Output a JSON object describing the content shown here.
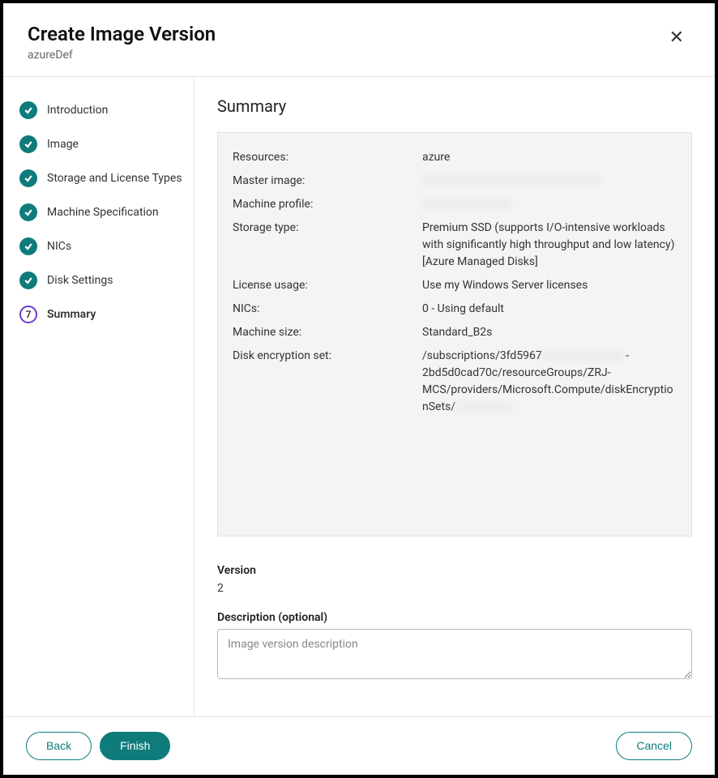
{
  "header": {
    "title": "Create Image Version",
    "subtitle": "azureDef"
  },
  "sidebar": {
    "steps": [
      {
        "label": "Introduction",
        "state": "done"
      },
      {
        "label": "Image",
        "state": "done"
      },
      {
        "label": "Storage and License Types",
        "state": "done"
      },
      {
        "label": "Machine Specification",
        "state": "done"
      },
      {
        "label": "NICs",
        "state": "done"
      },
      {
        "label": "Disk Settings",
        "state": "done"
      },
      {
        "label": "Summary",
        "state": "current",
        "number": "7"
      }
    ]
  },
  "main": {
    "heading": "Summary",
    "summary": {
      "resources": {
        "label": "Resources:",
        "value": "azure"
      },
      "master_image": {
        "label": "Master image:",
        "value": ""
      },
      "machine_profile": {
        "label": "Machine profile:",
        "value": ""
      },
      "storage_type": {
        "label": "Storage type:",
        "value": "Premium SSD (supports I/O-intensive workloads with significantly high throughput and low latency) [Azure Managed Disks]"
      },
      "license_usage": {
        "label": "License usage:",
        "value": "Use my Windows Server licenses"
      },
      "nics": {
        "label": "NICs:",
        "value": "0 - Using default"
      },
      "machine_size": {
        "label": "Machine size:",
        "value": "Standard_B2s"
      },
      "disk_encryption": {
        "label": "Disk encryption set:",
        "value_prefix": "/subscriptions/3fd5967",
        "value_mid": "2bd5d0cad70c/resourceGroups/ZRJ-MCS/providers/Microsoft.Compute/diskEncryptionSets/"
      }
    },
    "version": {
      "label": "Version",
      "value": "2"
    },
    "description": {
      "label": "Description (optional)",
      "placeholder": "Image version description",
      "value": ""
    }
  },
  "footer": {
    "back": "Back",
    "finish": "Finish",
    "cancel": "Cancel"
  }
}
